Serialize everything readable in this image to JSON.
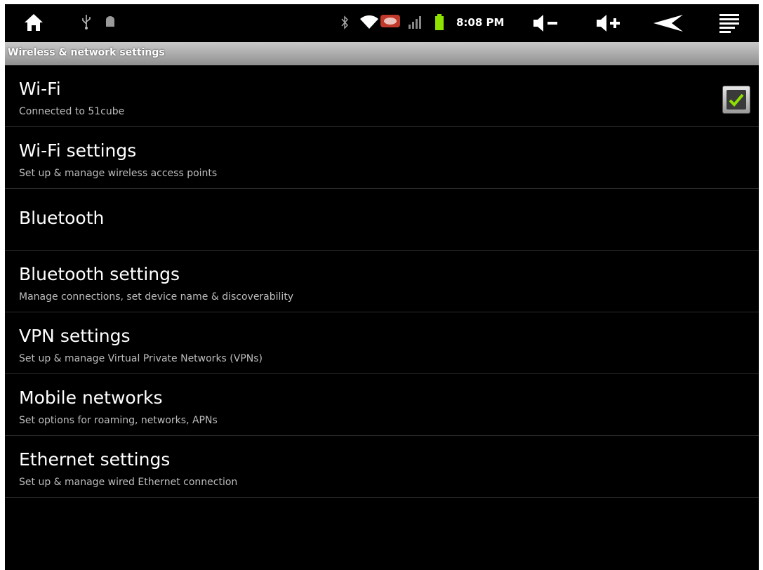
{
  "status_bar": {
    "time": "8:08 PM",
    "icons": [
      "home-icon",
      "usb-icon",
      "android-debug-icon",
      "bluetooth-icon",
      "wifi-icon",
      "notification-icon",
      "signal-icon",
      "battery-icon",
      "volume-down-icon",
      "volume-up-icon",
      "back-icon",
      "menu-icon"
    ],
    "battery_color": "#8ee200"
  },
  "title_bar": {
    "title": "Wireless & network settings"
  },
  "settings": [
    {
      "title": "Wi-Fi",
      "summary": "Connected to 51cube",
      "checked": true
    },
    {
      "title": "Wi-Fi settings",
      "summary": "Set up & manage wireless access points"
    },
    {
      "title": "Bluetooth",
      "summary": ""
    },
    {
      "title": "Bluetooth settings",
      "summary": "Manage connections, set device name & discoverability"
    },
    {
      "title": "VPN settings",
      "summary": "Set up & manage Virtual Private Networks (VPNs)"
    },
    {
      "title": "Mobile networks",
      "summary": "Set options for roaming, networks, APNs"
    },
    {
      "title": "Ethernet settings",
      "summary": "Set up & manage wired Ethernet connection"
    }
  ],
  "colors": {
    "background": "#000000",
    "title_bar": "#a8a8a8",
    "check_mark": "#8ee200"
  }
}
